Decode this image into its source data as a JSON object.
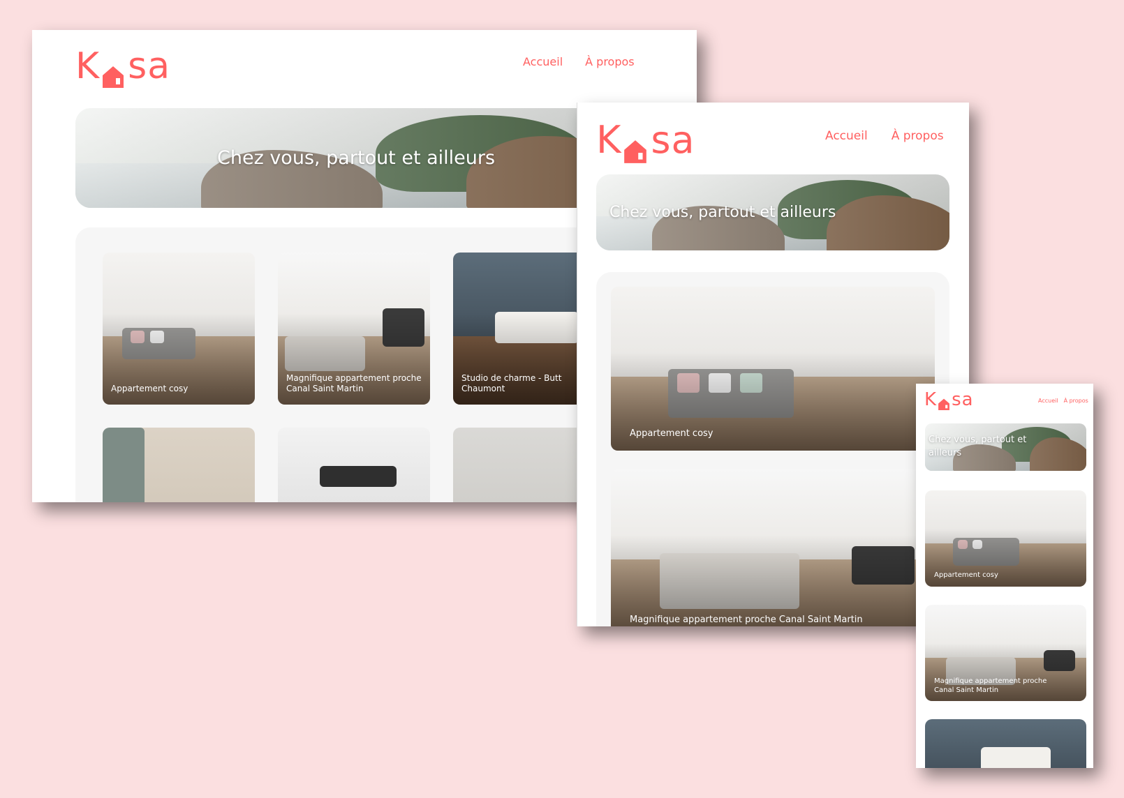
{
  "brand": {
    "logo_left": "K",
    "logo_right": "sa",
    "color": "#ff6060",
    "logo_icon": "house-icon"
  },
  "nav": {
    "home": "Accueil",
    "about": "À propos"
  },
  "hero": {
    "title": "Chez vous, partout et ailleurs"
  },
  "listings": [
    {
      "title": "Appartement cosy"
    },
    {
      "title": "Magnifique appartement proche Canal Saint Martin"
    },
    {
      "title": "Studio de charme - Buttes Chaumont"
    }
  ],
  "desktop_card3_visible": "Studio de charme - Butt",
  "desktop_card3_line2": "Chaumont",
  "desktop_card2_line1": "Magnifique appartement proche",
  "desktop_card2_line2": "Canal Saint Martin",
  "mobile_hero_line1": "Chez vous, partout et",
  "mobile_hero_line2": "ailleurs",
  "colors": {
    "background": "#fbdfe0",
    "accent": "#ff6060",
    "gallery_bg": "#f6f6f6"
  }
}
